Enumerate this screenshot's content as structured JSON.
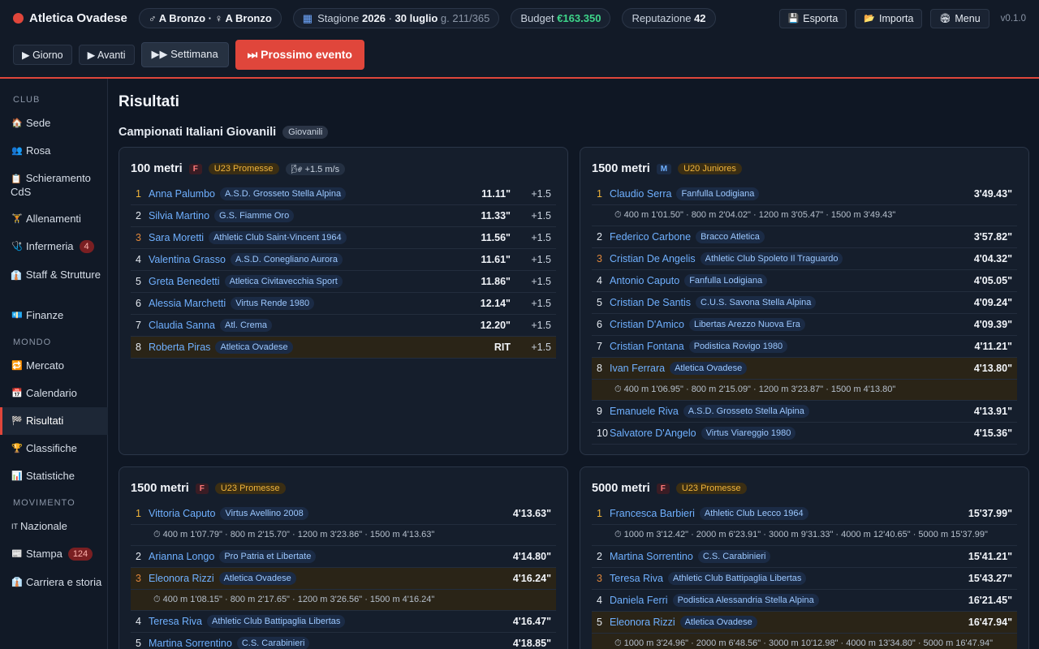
{
  "topbar": {
    "club_name": "Atletica Ovadese",
    "division_label": "♂ A Bronzo · ♀ A Bronzo",
    "season_label": "Stagione",
    "season_year": "2026",
    "season_date": "30 luglio",
    "season_day": "g. 211/365",
    "budget_label": "Budget",
    "budget_value": "€163.350",
    "reputation_label": "Reputazione",
    "reputation_value": "42",
    "export_label": "Esporta",
    "import_label": "Importa",
    "menu_label": "Menu",
    "version": "v0.1.0"
  },
  "controls": {
    "day_label": "▶ Giorno",
    "next_label": "▶ Avanti",
    "week_label": "▶▶ Settimana",
    "next_event_label": "⏭ Prossimo evento"
  },
  "sidebar": {
    "section_club": "CLUB",
    "section_world": "MONDO",
    "section_movement": "MOVIMENTO",
    "items": [
      {
        "label": "Sede",
        "icon": "🏠"
      },
      {
        "label": "Rosa",
        "icon": "👥"
      },
      {
        "label": "Schieramento CdS",
        "icon": "📋"
      },
      {
        "label": "Allenamenti",
        "icon": "🏋"
      },
      {
        "label": "Infermeria",
        "icon": "🩺",
        "badge": "4"
      },
      {
        "label": "Staff & Strutture",
        "icon": "👔"
      },
      {
        "label": "Finanze",
        "icon": "💶"
      },
      {
        "label": "Mercato",
        "icon": "🔁"
      },
      {
        "label": "Calendario",
        "icon": "📅"
      },
      {
        "label": "Risultati",
        "icon": "🏁"
      },
      {
        "label": "Classifiche",
        "icon": "🏆"
      },
      {
        "label": "Statistiche",
        "icon": "📊"
      },
      {
        "label": "Nazionale",
        "icon": "IT"
      },
      {
        "label": "Stampa",
        "icon": "📰",
        "badge": "124"
      },
      {
        "label": "Carriera e storia",
        "icon": "👔"
      }
    ]
  },
  "main": {
    "title": "Risultati",
    "section_title": "Campionati Italiani Giovanili",
    "section_tag": "Giovanili",
    "cards": [
      {
        "event": "100 metri",
        "sex": "F",
        "category": "U23 Promesse",
        "wind": "🌬 +1.5 m/s",
        "rows": [
          {
            "pos": "1",
            "athlete": "Anna Palumbo",
            "club": "A.S.D. Grosseto Stella Alpina",
            "time": "11.11\"",
            "wind": "+1.5"
          },
          {
            "pos": "2",
            "athlete": "Silvia Martino",
            "club": "G.S. Fiamme Oro",
            "time": "11.33\"",
            "wind": "+1.5"
          },
          {
            "pos": "3",
            "athlete": "Sara Moretti",
            "club": "Athletic Club Saint-Vincent 1964",
            "time": "11.56\"",
            "wind": "+1.5"
          },
          {
            "pos": "4",
            "athlete": "Valentina Grasso",
            "club": "A.S.D. Conegliano Aurora",
            "time": "11.61\"",
            "wind": "+1.5"
          },
          {
            "pos": "5",
            "athlete": "Greta Benedetti",
            "club": "Atletica Civitavecchia Sport",
            "time": "11.86\"",
            "wind": "+1.5"
          },
          {
            "pos": "6",
            "athlete": "Alessia Marchetti",
            "club": "Virtus Rende 1980",
            "time": "12.14\"",
            "wind": "+1.5"
          },
          {
            "pos": "7",
            "athlete": "Claudia Sanna",
            "club": "Atl. Crema",
            "time": "12.20\"",
            "wind": "+1.5"
          },
          {
            "pos": "8",
            "athlete": "Roberta Piras",
            "club": "Atletica Ovadese",
            "time": "RIT",
            "wind": "+1.5"
          }
        ]
      },
      {
        "event": "1500 metri",
        "sex": "M",
        "category": "U20 Juniores",
        "rows": [
          {
            "pos": "1",
            "athlete": "Claudio Serra",
            "club": "Fanfulla Lodigiana",
            "time": "3'49.43\"",
            "splits": "⏱ 400 m 1'01.50\" · 800 m 2'04.02\" · 1200 m 3'05.47\" · 1500 m 3'49.43\""
          },
          {
            "pos": "2",
            "athlete": "Federico Carbone",
            "club": "Bracco Atletica",
            "time": "3'57.82\""
          },
          {
            "pos": "3",
            "athlete": "Cristian De Angelis",
            "club": "Athletic Club Spoleto Il Traguardo",
            "time": "4'04.32\""
          },
          {
            "pos": "4",
            "athlete": "Antonio Caputo",
            "club": "Fanfulla Lodigiana",
            "time": "4'05.05\""
          },
          {
            "pos": "5",
            "athlete": "Cristian De Santis",
            "club": "C.U.S. Savona Stella Alpina",
            "time": "4'09.24\""
          },
          {
            "pos": "6",
            "athlete": "Cristian D'Amico",
            "club": "Libertas Arezzo Nuova Era",
            "time": "4'09.39\""
          },
          {
            "pos": "7",
            "athlete": "Cristian Fontana",
            "club": "Podistica Rovigo 1980",
            "time": "4'11.21\""
          },
          {
            "pos": "8",
            "athlete": "Ivan Ferrara",
            "club": "Atletica Ovadese",
            "time": "4'13.80\"",
            "splits": "⏱ 400 m 1'06.95\" · 800 m 2'15.09\" · 1200 m 3'23.87\" · 1500 m 4'13.80\""
          },
          {
            "pos": "9",
            "athlete": "Emanuele Riva",
            "club": "A.S.D. Grosseto Stella Alpina",
            "time": "4'13.91\""
          },
          {
            "pos": "10",
            "athlete": "Salvatore D'Angelo",
            "club": "Virtus Viareggio 1980",
            "time": "4'15.36\""
          }
        ]
      },
      {
        "event": "1500 metri",
        "sex": "F",
        "category": "U23 Promesse",
        "rows": [
          {
            "pos": "1",
            "athlete": "Vittoria Caputo",
            "club": "Virtus Avellino 2008",
            "time": "4'13.63\"",
            "splits": "⏱ 400 m 1'07.79\" · 800 m 2'15.70\" · 1200 m 3'23.86\" · 1500 m 4'13.63\""
          },
          {
            "pos": "2",
            "athlete": "Arianna Longo",
            "club": "Pro Patria et Libertate",
            "time": "4'14.80\""
          },
          {
            "pos": "3",
            "athlete": "Eleonora Rizzi",
            "club": "Atletica Ovadese",
            "time": "4'16.24\"",
            "splits": "⏱ 400 m 1'08.15\" · 800 m 2'17.65\" · 1200 m 3'26.56\" · 1500 m 4'16.24\""
          },
          {
            "pos": "4",
            "athlete": "Teresa Riva",
            "club": "Athletic Club Battipaglia Libertas",
            "time": "4'16.47\""
          },
          {
            "pos": "5",
            "athlete": "Martina Sorrentino",
            "club": "C.S. Carabinieri",
            "time": "4'18.85\""
          }
        ]
      },
      {
        "event": "5000 metri",
        "sex": "F",
        "category": "U23 Promesse",
        "rows": [
          {
            "pos": "1",
            "athlete": "Francesca Barbieri",
            "club": "Athletic Club Lecco 1964",
            "time": "15'37.99\"",
            "splits": "⏱ 1000 m 3'12.42\" · 2000 m 6'23.91\" · 3000 m 9'31.33\" · 4000 m 12'40.65\" · 5000 m 15'37.99\""
          },
          {
            "pos": "2",
            "athlete": "Martina Sorrentino",
            "club": "C.S. Carabinieri",
            "time": "15'41.21\""
          },
          {
            "pos": "3",
            "athlete": "Teresa Riva",
            "club": "Athletic Club Battipaglia Libertas",
            "time": "15'43.27\""
          },
          {
            "pos": "4",
            "athlete": "Daniela Ferri",
            "club": "Podistica Alessandria Stella Alpina",
            "time": "16'21.45\""
          },
          {
            "pos": "5",
            "athlete": "Eleonora Rizzi",
            "club": "Atletica Ovadese",
            "time": "16'47.94\"",
            "splits": "⏱ 1000 m 3'24.96\" · 2000 m 6'48.56\" · 3000 m 10'12.98\" · 4000 m 13'34.80\" · 5000 m 16'47.94\""
          }
        ]
      }
    ]
  }
}
